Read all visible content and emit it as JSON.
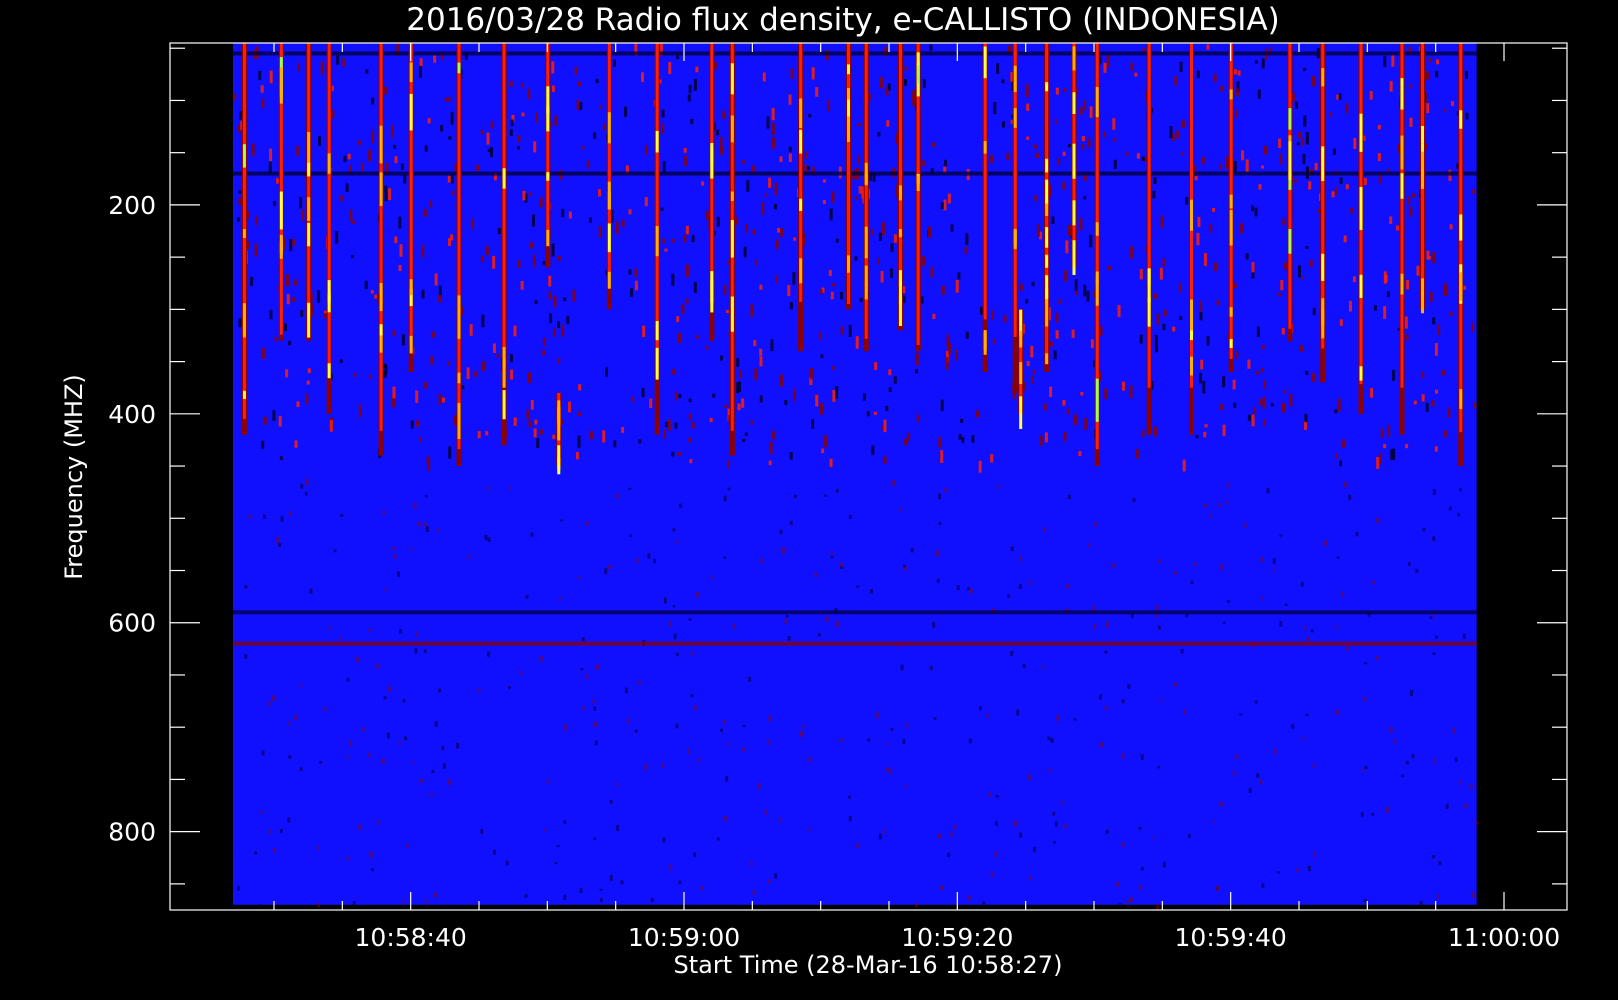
{
  "chart_data": {
    "type": "heatmap",
    "title": "2016/03/28  Radio flux density, e-CALLISTO (INDONESIA)",
    "xlabel": "Start Time (28-Mar-16 10:58:27)",
    "ylabel": "Frequency (MHZ)",
    "x_ticks": [
      "10:58:40",
      "10:59:00",
      "10:59:20",
      "10:59:40",
      "11:00:00"
    ],
    "x_tick_seconds": [
      13,
      33,
      53,
      73,
      93
    ],
    "xlim_seconds": [
      0,
      93
    ],
    "y_ticks": [
      200,
      400,
      600,
      800
    ],
    "ylim": [
      875,
      45
    ],
    "data_extent": {
      "time_seconds": [
        0,
        91
      ],
      "frequency_mhz": [
        45,
        870
      ]
    },
    "colormap": [
      "#000030",
      "#1010ff",
      "#8b0000",
      "#ff2000",
      "#ffb000",
      "#ffff40",
      "#a0ff50"
    ],
    "background_color": "#1010ff",
    "bursts": [
      {
        "t": 0.8,
        "f0": 45,
        "f1": 420,
        "intensity": 0.9
      },
      {
        "t": 3.5,
        "f0": 45,
        "f1": 330,
        "intensity": 0.95
      },
      {
        "t": 5.5,
        "f0": 45,
        "f1": 330,
        "intensity": 0.8
      },
      {
        "t": 7.0,
        "f0": 45,
        "f1": 400,
        "intensity": 0.7
      },
      {
        "t": 10.8,
        "f0": 45,
        "f1": 440,
        "intensity": 0.85
      },
      {
        "t": 13.0,
        "f0": 45,
        "f1": 360,
        "intensity": 0.8
      },
      {
        "t": 16.5,
        "f0": 45,
        "f1": 450,
        "intensity": 0.9
      },
      {
        "t": 19.8,
        "f0": 45,
        "f1": 430,
        "intensity": 0.6
      },
      {
        "t": 23.0,
        "f0": 45,
        "f1": 260,
        "intensity": 0.7
      },
      {
        "t": 23.8,
        "f0": 380,
        "f1": 450,
        "intensity": 0.8
      },
      {
        "t": 27.5,
        "f0": 45,
        "f1": 300,
        "intensity": 0.8
      },
      {
        "t": 31.0,
        "f0": 45,
        "f1": 420,
        "intensity": 0.6
      },
      {
        "t": 35.0,
        "f0": 45,
        "f1": 330,
        "intensity": 0.7
      },
      {
        "t": 36.5,
        "f0": 45,
        "f1": 440,
        "intensity": 0.85
      },
      {
        "t": 41.5,
        "f0": 45,
        "f1": 340,
        "intensity": 0.6
      },
      {
        "t": 45.0,
        "f0": 45,
        "f1": 300,
        "intensity": 0.95
      },
      {
        "t": 46.3,
        "f0": 45,
        "f1": 340,
        "intensity": 0.9
      },
      {
        "t": 48.8,
        "f0": 45,
        "f1": 320,
        "intensity": 0.8
      },
      {
        "t": 50.1,
        "f0": 45,
        "f1": 340,
        "intensity": 0.95
      },
      {
        "t": 55.0,
        "f0": 45,
        "f1": 360,
        "intensity": 0.6
      },
      {
        "t": 57.2,
        "f0": 45,
        "f1": 380,
        "intensity": 0.6
      },
      {
        "t": 57.6,
        "f0": 300,
        "f1": 400,
        "intensity": 0.8
      },
      {
        "t": 59.5,
        "f0": 45,
        "f1": 250,
        "intensity": 0.7
      },
      {
        "t": 59.5,
        "f0": 220,
        "f1": 360,
        "intensity": 0.85
      },
      {
        "t": 61.5,
        "f0": 45,
        "f1": 260,
        "intensity": 0.75
      },
      {
        "t": 63.2,
        "f0": 45,
        "f1": 450,
        "intensity": 0.9
      },
      {
        "t": 67.0,
        "f0": 45,
        "f1": 420,
        "intensity": 0.7
      },
      {
        "t": 70.1,
        "f0": 45,
        "f1": 420,
        "intensity": 0.7
      },
      {
        "t": 73.0,
        "f0": 45,
        "f1": 360,
        "intensity": 0.9
      },
      {
        "t": 77.3,
        "f0": 45,
        "f1": 330,
        "intensity": 0.9
      },
      {
        "t": 79.7,
        "f0": 45,
        "f1": 370,
        "intensity": 0.75
      },
      {
        "t": 82.5,
        "f0": 45,
        "f1": 400,
        "intensity": 0.8
      },
      {
        "t": 85.5,
        "f0": 45,
        "f1": 420,
        "intensity": 0.7
      },
      {
        "t": 87.0,
        "f0": 45,
        "f1": 300,
        "intensity": 0.75
      },
      {
        "t": 89.8,
        "f0": 45,
        "f1": 450,
        "intensity": 0.8
      }
    ],
    "horizontal_bands": [
      {
        "f": 55,
        "color": "#000030"
      },
      {
        "f": 170,
        "color": "#000030"
      },
      {
        "f": 590,
        "color": "#000040"
      },
      {
        "f": 620,
        "color": "#8b0000"
      }
    ]
  }
}
